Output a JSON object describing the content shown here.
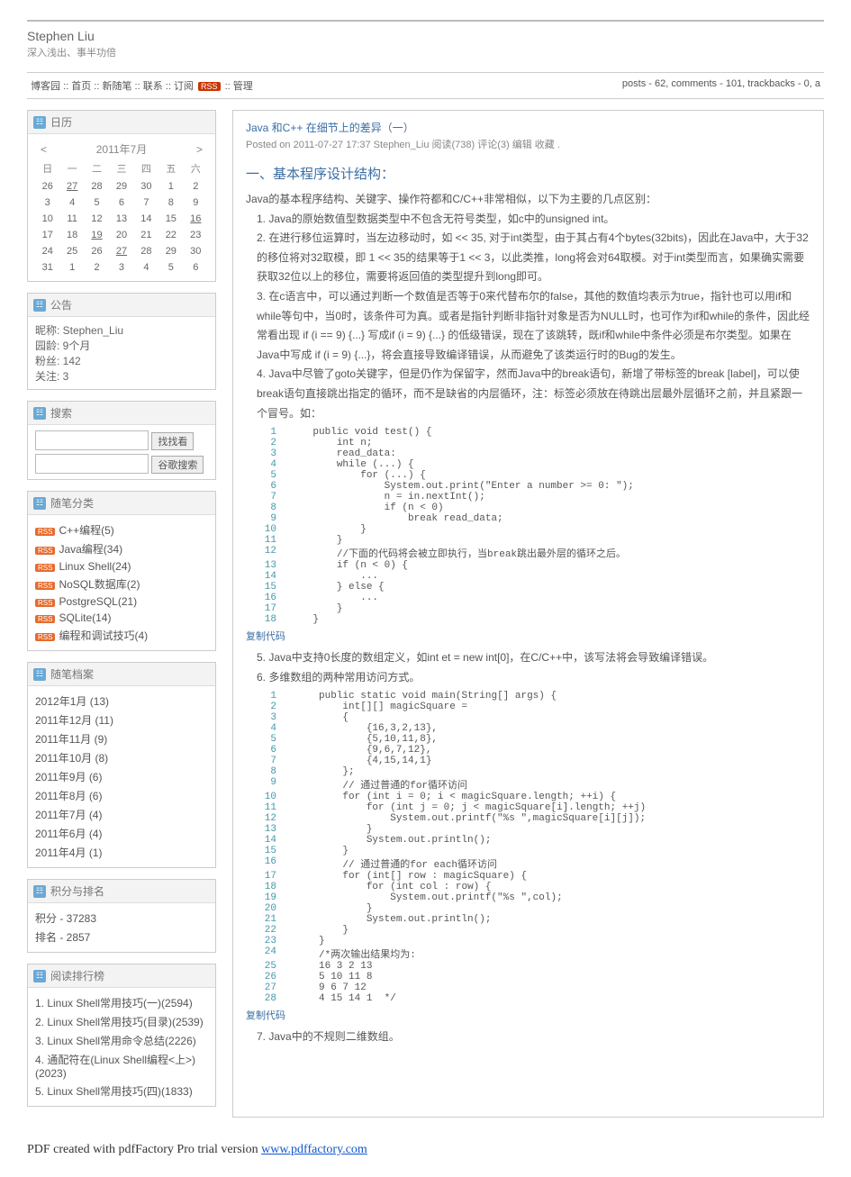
{
  "header": {
    "title": "Stephen Liu",
    "subtitle": "深入浅出、事半功倍"
  },
  "nav": {
    "label_prefix": "博客园",
    "items": [
      "首页",
      "新随笔",
      "联系",
      "订阅",
      "管理"
    ],
    "badge": "RSS",
    "stats": "posts - 62, comments - 101, trackbacks - 0, a"
  },
  "calendar": {
    "title": "日历",
    "month": "2011年7月",
    "prev": "<",
    "next": ">",
    "dow": [
      "日",
      "一",
      "二",
      "三",
      "四",
      "五",
      "六"
    ],
    "rows": [
      [
        "26",
        "27",
        "28",
        "29",
        "30",
        "1",
        "2"
      ],
      [
        "3",
        "4",
        "5",
        "6",
        "7",
        "8",
        "9"
      ],
      [
        "10",
        "11",
        "12",
        "13",
        "14",
        "15",
        "16"
      ],
      [
        "17",
        "18",
        "19",
        "20",
        "21",
        "22",
        "23"
      ],
      [
        "24",
        "25",
        "26",
        "27",
        "28",
        "29",
        "30"
      ],
      [
        "31",
        "1",
        "2",
        "3",
        "4",
        "5",
        "6"
      ]
    ],
    "linked": [
      "16",
      "19",
      "27"
    ]
  },
  "announce": {
    "title": "公告",
    "rows": [
      {
        "k": "昵称:",
        "v": "Stephen_Liu"
      },
      {
        "k": "园龄:",
        "v": "9个月"
      },
      {
        "k": "粉丝:",
        "v": "142"
      },
      {
        "k": "关注:",
        "v": "3"
      }
    ]
  },
  "search": {
    "title": "搜索",
    "btn1": "找找看",
    "btn2": "谷歌搜索"
  },
  "cats": {
    "title": "随笔分类",
    "items": [
      "C++编程(5)",
      "Java编程(34)",
      "Linux Shell(24)",
      "NoSQL数据库(2)",
      "PostgreSQL(21)",
      "SQLite(14)",
      "编程和调试技巧(4)"
    ]
  },
  "arch": {
    "title": "随笔档案",
    "items": [
      "2012年1月 (13)",
      "2011年12月 (11)",
      "2011年11月 (9)",
      "2011年10月 (8)",
      "2011年9月 (6)",
      "2011年8月 (6)",
      "2011年7月 (4)",
      "2011年6月 (4)",
      "2011年4月 (1)"
    ]
  },
  "rank": {
    "title": "积分与排名",
    "items": [
      "积分 - 37283",
      "排名 - 2857"
    ]
  },
  "hot": {
    "title": "阅读排行榜",
    "items": [
      "1. Linux Shell常用技巧(一)(2594)",
      "2. Linux Shell常用技巧(目录)(2539)",
      "3. Linux Shell常用命令总结(2226)",
      "4. 通配符在(Linux Shell编程<上>)(2023)",
      "5. Linux Shell常用技巧(四)(1833)"
    ]
  },
  "post": {
    "title": "Java 和C++ 在细节上的差异（一）",
    "meta": "Posted on 2011-07-27 17:37 Stephen_Liu 阅读(738) 评论(3) 编辑 收藏 .",
    "section": "一、基本程序设计结构："
  },
  "para": {
    "intro": "Java的基本程序结构、关键字、操作符都和C/C++非常相似，以下为主要的几点区别：",
    "p1": "1.    Java的原始数值型数据类型中不包含无符号类型，如c中的unsigned int。",
    "p2": "2.    在进行移位运算时，当左边移动时，如 << 35, 对于int类型，由于其占有4个bytes(32bits)，因此在Java中，大于32的移位将对32取模，即 1 << 35的结果等于1 << 3，以此类推，long将会对64取模。对于int类型而言，如果确实需要获取32位以上的移位，需要将返回值的类型提升到long即可。",
    "p3": "3.    在c语言中，可以通过判断一个数值是否等于0来代替布尔的false，其他的数值均表示为true，指针也可以用if和while等句中，当0时，该条件可为真。或者是指针判断非指针对象是否为NULL时，也可作为if和while的条件，因此经常看出现 if (i == 9) {...} 写成if (i = 9) {...} 的低级错误，现在了该跳转，既if和while中条件必须是布尔类型。如果在Java中写成 if (i = 9) {...}，将会直接导致编译错误，从而避免了该类运行时的Bug的发生。",
    "p4": "4.    Java中尽管了goto关键字，但是仍作为保留字，然而Java中的break语句，新增了带标签的break [label]，可以使break语句直接跳出指定的循环，而不是缺省的内层循环，注：标签必须放在待跳出层最外层循环之前，并且紧跟一个冒号。如：",
    "p5": "5.    Java中支持0长度的数组定义，如int et = new int[0]，在C/C++中，该写法将会导致编译错误。",
    "p6": "6.    多维数组的两种常用访问方式。",
    "p7": "7.    Java中的不规则二维数组。"
  },
  "code1": [
    {
      "ln": "1",
      "txt": "    <kw>public</kw> <kw>void</kw> test() {"
    },
    {
      "ln": "2",
      "txt": "        <kw>int</kw> n;"
    },
    {
      "ln": "3",
      "txt": "        read_data:"
    },
    {
      "ln": "4",
      "txt": "        <kw>while</kw> (...) {"
    },
    {
      "ln": "5",
      "txt": "            <kw>for</kw> (...) {"
    },
    {
      "ln": "6",
      "txt": "                System.out.print(<str>\"Enter a number >= 0: \"</str>);"
    },
    {
      "ln": "7",
      "txt": "                n = in.nextInt();"
    },
    {
      "ln": "8",
      "txt": "                <kw>if</kw> (n &lt; 0)"
    },
    {
      "ln": "9",
      "txt": "                    <kw>break</kw> read_data;"
    },
    {
      "ln": "10",
      "txt": "            }"
    },
    {
      "ln": "11",
      "txt": "        }"
    },
    {
      "ln": "12",
      "txt": "        <cmt>//下面的代码将会被立即执行，当break跳出最外层的循环之后。</cmt>"
    },
    {
      "ln": "13",
      "txt": "        <kw>if</kw> (n &lt; 0) {"
    },
    {
      "ln": "14",
      "txt": "            ..."
    },
    {
      "ln": "15",
      "txt": "        } <kw>else</kw> {"
    },
    {
      "ln": "16",
      "txt": "            ..."
    },
    {
      "ln": "17",
      "txt": "        }"
    },
    {
      "ln": "18",
      "txt": "    }"
    }
  ],
  "code2": [
    {
      "ln": "1",
      "txt": "     <kw>public</kw> <kw>static</kw> <kw>void</kw> main(String[] args) {"
    },
    {
      "ln": "2",
      "txt": "         <kw>int</kw>[][] magicSquare ="
    },
    {
      "ln": "3",
      "txt": "         {"
    },
    {
      "ln": "4",
      "txt": "             {16,3,2,13},"
    },
    {
      "ln": "5",
      "txt": "             {5,10,11,8},"
    },
    {
      "ln": "6",
      "txt": "             {9,6,7,12},"
    },
    {
      "ln": "7",
      "txt": "             {4,15,14,1}"
    },
    {
      "ln": "8",
      "txt": "         };"
    },
    {
      "ln": "9",
      "txt": "         <cmt>// 通过普通的for循环访问</cmt>"
    },
    {
      "ln": "10",
      "txt": "         <kw>for</kw> (<kw>int</kw> i = 0; i &lt; magicSquare.length; ++i) {"
    },
    {
      "ln": "11",
      "txt": "             <kw>for</kw> (<kw>int</kw> j = 0; j &lt; magicSquare[i].length; ++j)"
    },
    {
      "ln": "12",
      "txt": "                 System.out.printf(<str>\"%s \"</str>,magicSquare[i][j]);"
    },
    {
      "ln": "13",
      "txt": "             }"
    },
    {
      "ln": "14",
      "txt": "             System.out.println();"
    },
    {
      "ln": "15",
      "txt": "         }"
    },
    {
      "ln": "16",
      "txt": "         <cmt>// 通过普通的for each循环访问</cmt>"
    },
    {
      "ln": "17",
      "txt": "         <kw>for</kw> (<kw>int</kw>[] row : magicSquare) {"
    },
    {
      "ln": "18",
      "txt": "             <kw>for</kw> (<kw>int</kw> col : row) {"
    },
    {
      "ln": "19",
      "txt": "                 System.out.printf(<str>\"%s \"</str>,col);"
    },
    {
      "ln": "20",
      "txt": "             }"
    },
    {
      "ln": "21",
      "txt": "             System.out.println();"
    },
    {
      "ln": "22",
      "txt": "         }"
    },
    {
      "ln": "23",
      "txt": "     }"
    },
    {
      "ln": "24",
      "txt": "     <cmt>/*两次输出结果均为:</cmt>"
    },
    {
      "ln": "25",
      "txt": "<cmt>     16 3 2 13</cmt>"
    },
    {
      "ln": "26",
      "txt": "<cmt>     5 10 11 8</cmt>"
    },
    {
      "ln": "27",
      "txt": "<cmt>     9 6 7 12</cmt>"
    },
    {
      "ln": "28",
      "txt": "<cmt>     4 15 14 1  */</cmt>"
    }
  ],
  "copy": "复制代码",
  "footer": {
    "text": "PDF created with pdfFactory Pro trial version ",
    "link": "www.pdffactory.com"
  }
}
